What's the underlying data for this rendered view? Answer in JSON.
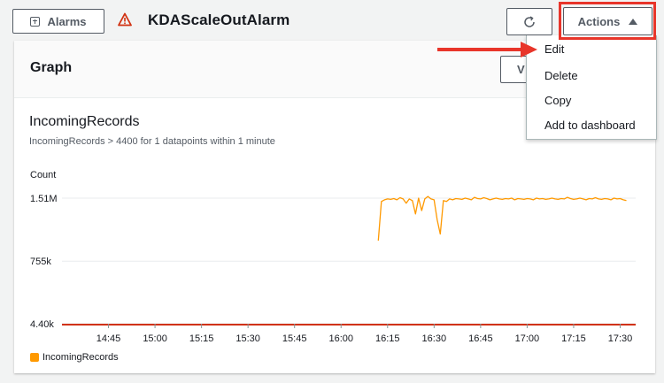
{
  "header": {
    "alarms_label": "Alarms",
    "alarm_name": "KDAScaleOutAlarm",
    "actions_label": "Actions"
  },
  "panel": {
    "title": "Graph",
    "view_label": "V"
  },
  "menu": {
    "items": [
      "Edit",
      "Delete",
      "Copy",
      "Add to dashboard"
    ]
  },
  "metric": {
    "title": "IncomingRecords",
    "condition": "IncomingRecords > 4400 for 1 datapoints within 1 minute"
  },
  "colors": {
    "series": "#ff9900",
    "threshold": "#d13212",
    "highlight": "#e8352a",
    "warning": "#d13212"
  },
  "icons": [
    "plus-box-icon",
    "warning-icon",
    "refresh-icon",
    "caret-up-icon",
    "arrow-annotation"
  ],
  "chart_data": {
    "type": "line",
    "ylabel": "Count",
    "y_ticks": [
      "1.51M",
      "755k",
      "4.40k"
    ],
    "y_tick_values": [
      1510000,
      755000,
      4400
    ],
    "x_ticks": [
      "14:45",
      "15:00",
      "15:15",
      "15:30",
      "15:45",
      "16:00",
      "16:15",
      "16:30",
      "16:45",
      "17:00",
      "17:15",
      "17:30"
    ],
    "x_start_minutes": 870,
    "x_end_minutes": 1055,
    "threshold": 4400,
    "series": [
      {
        "name": "IncomingRecords",
        "points": [
          [
            972,
            1000000
          ],
          [
            973,
            1470000
          ],
          [
            974,
            1490000
          ],
          [
            975,
            1500000
          ],
          [
            976,
            1495000
          ],
          [
            977,
            1505000
          ],
          [
            978,
            1490000
          ],
          [
            979,
            1515000
          ],
          [
            980,
            1500000
          ],
          [
            981,
            1450000
          ],
          [
            982,
            1500000
          ],
          [
            983,
            1480000
          ],
          [
            984,
            1320000
          ],
          [
            985,
            1510000
          ],
          [
            986,
            1360000
          ],
          [
            987,
            1500000
          ],
          [
            988,
            1530000
          ],
          [
            989,
            1500000
          ],
          [
            990,
            1490000
          ],
          [
            991,
            1250000
          ],
          [
            992,
            1080000
          ],
          [
            993,
            1480000
          ],
          [
            994,
            1470000
          ],
          [
            995,
            1500000
          ],
          [
            996,
            1490000
          ],
          [
            997,
            1505000
          ],
          [
            998,
            1500000
          ],
          [
            999,
            1495000
          ],
          [
            1000,
            1510000
          ],
          [
            1001,
            1500000
          ],
          [
            1002,
            1490000
          ],
          [
            1003,
            1520000
          ],
          [
            1004,
            1505000
          ],
          [
            1005,
            1500000
          ],
          [
            1006,
            1515000
          ],
          [
            1007,
            1505000
          ],
          [
            1008,
            1490000
          ],
          [
            1009,
            1500000
          ],
          [
            1010,
            1510000
          ],
          [
            1011,
            1500000
          ],
          [
            1012,
            1495000
          ],
          [
            1013,
            1505000
          ],
          [
            1014,
            1500000
          ],
          [
            1015,
            1510000
          ],
          [
            1016,
            1490000
          ],
          [
            1017,
            1505000
          ],
          [
            1018,
            1500000
          ],
          [
            1019,
            1495000
          ],
          [
            1020,
            1505000
          ],
          [
            1021,
            1500000
          ],
          [
            1022,
            1490000
          ],
          [
            1023,
            1510000
          ],
          [
            1024,
            1500000
          ],
          [
            1025,
            1505000
          ],
          [
            1026,
            1495000
          ],
          [
            1027,
            1500000
          ],
          [
            1028,
            1510000
          ],
          [
            1029,
            1500000
          ],
          [
            1030,
            1495000
          ],
          [
            1031,
            1505000
          ],
          [
            1032,
            1500000
          ],
          [
            1033,
            1520000
          ],
          [
            1034,
            1505000
          ],
          [
            1035,
            1495000
          ],
          [
            1036,
            1500000
          ],
          [
            1037,
            1510000
          ],
          [
            1038,
            1500000
          ],
          [
            1039,
            1490000
          ],
          [
            1040,
            1505000
          ],
          [
            1041,
            1500000
          ],
          [
            1042,
            1515000
          ],
          [
            1043,
            1500000
          ],
          [
            1044,
            1495000
          ],
          [
            1045,
            1505000
          ],
          [
            1046,
            1500000
          ],
          [
            1047,
            1490000
          ],
          [
            1048,
            1510000
          ],
          [
            1049,
            1500000
          ],
          [
            1050,
            1505000
          ],
          [
            1051,
            1490000
          ],
          [
            1052,
            1480000
          ]
        ]
      }
    ],
    "legend": [
      "IncomingRecords"
    ],
    "legend_position": "bottom-left"
  }
}
